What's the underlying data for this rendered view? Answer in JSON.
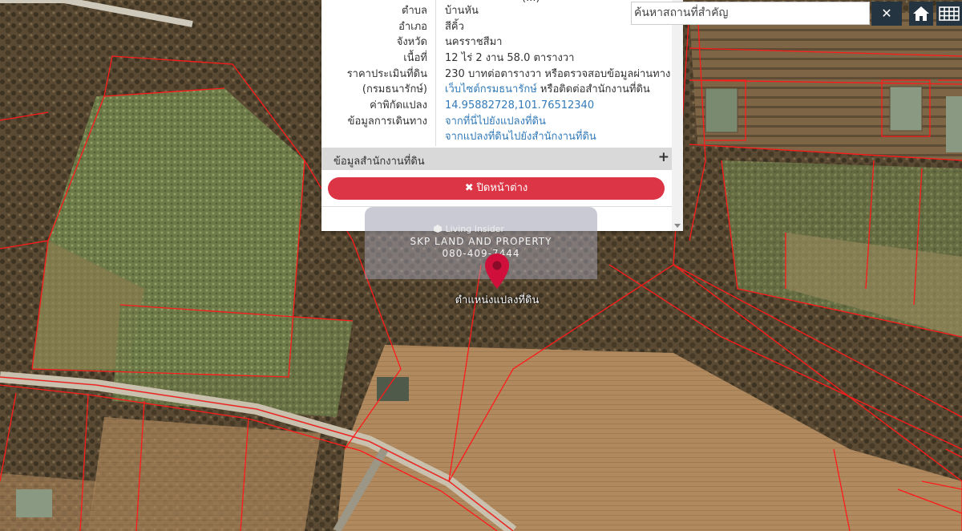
{
  "popup": {
    "partial_top_row": "(...)",
    "rows": [
      {
        "label": "ตำบล",
        "value": "บ้านหัน",
        "link": false
      },
      {
        "label": "อำเภอ",
        "value": "สีคิ้ว",
        "link": false
      },
      {
        "label": "จังหวัด",
        "value": "นครราชสีมา",
        "link": false
      },
      {
        "label": "เนื้อที่",
        "value": "12 ไร่ 2 งาน 58.0 ตารางวา",
        "link": false
      },
      {
        "label": "ราคาประเมินที่ดิน",
        "value": "230 บาทต่อตารางวา หรือตรวจสอบข้อมูลผ่านทาง",
        "link": false
      },
      {
        "label": "(กรมธนารักษ์)",
        "value": "เว็บไซต์กรมธนารักษ์",
        "value_suffix": " หรือติดต่อสำนักงานที่ดิน",
        "link": true
      },
      {
        "label": "ค่าพิกัดแปลง",
        "value": "14.95882728,101.76512340",
        "link": true
      },
      {
        "label": "ข้อมูลการเดินทาง",
        "value": "จากที่นี่ไปยังแปลงที่ดิน",
        "link": true
      },
      {
        "label": "",
        "value": "จากแปลงที่ดินไปยังสำนักงานที่ดิน",
        "link": true
      }
    ],
    "section_title": "ข้อมูลสำนักงานที่ดิน",
    "section_toggle": "+",
    "close_label": "ปิดหน้าต่าง",
    "close_icon": "✖"
  },
  "watermark": {
    "brand": "Living Insider",
    "company": "SKP LAND AND PROPERTY",
    "phone": "080-409-7444"
  },
  "marker": {
    "label": "ตำแหน่งแปลงที่ดิน",
    "color": "#d0103a"
  },
  "toolbar": {
    "search_placeholder": "ค้นหาสถานที่สำคัญ",
    "clear_label": "✕",
    "home_icon": "home-icon",
    "grid_icon": "grid-icon"
  },
  "colors": {
    "parcel_line": "#ff1a1a",
    "toolbar_bg": "#253441",
    "close_button": "#dc3545",
    "link": "#337ab7"
  }
}
